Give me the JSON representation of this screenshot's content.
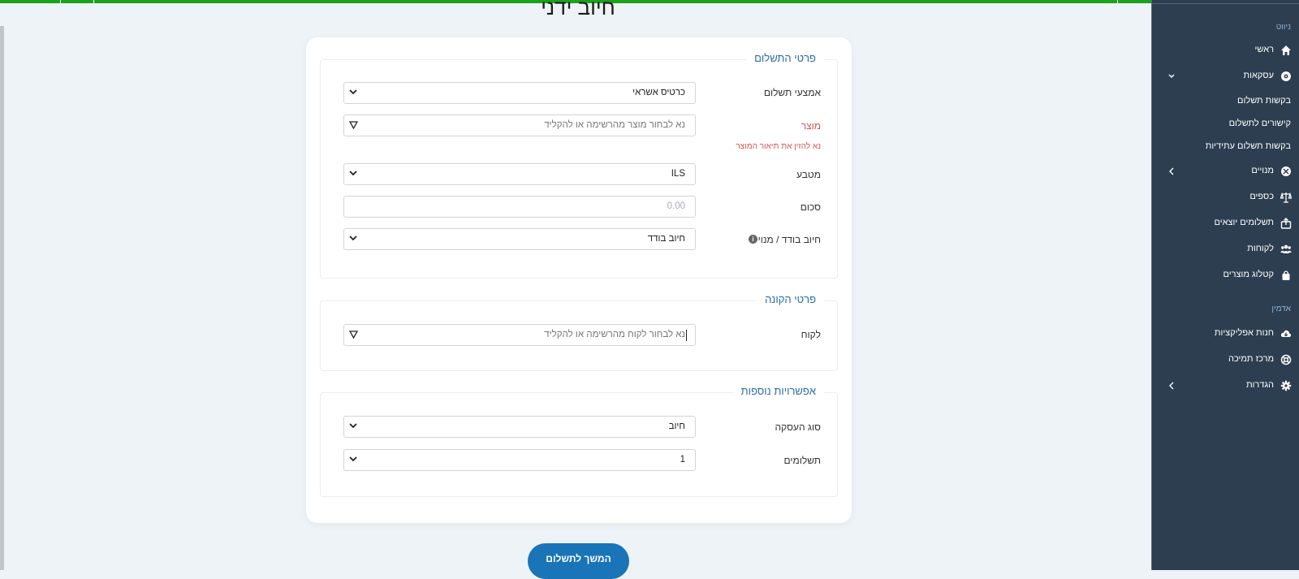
{
  "page": {
    "title": "חיוב ידני",
    "cta_label": "המשך לתשלום"
  },
  "payment_section": {
    "legend": "פרטי התשלום",
    "method_label": "אמצעי תשלום",
    "method_value": "כרטיס אשראי",
    "product_label": "מוצר",
    "product_placeholder": "נא לבחור מוצר מהרשימה או להקליד",
    "product_error": "נא להזין את תיאור המוצר",
    "currency_label": "מטבע",
    "currency_value": "ILS",
    "amount_label": "סכום",
    "amount_placeholder": "0.00",
    "charge_type_label": "חיוב בודד / מנוי",
    "charge_type_value": "חיוב בודד"
  },
  "buyer_section": {
    "legend": "פרטי הקונה",
    "customer_label": "לקוח",
    "customer_placeholder": "נא לבחור לקוח מהרשימה או להקליד"
  },
  "extra_section": {
    "legend": "אפשרויות נוספות",
    "transaction_type_label": "סוג העסקה",
    "transaction_type_value": "חיוב",
    "installments_label": "תשלומים",
    "installments_value": "1"
  },
  "sidebar": {
    "nav_header": "ניווט",
    "admin_header": "אדמין",
    "items": {
      "home": "ראשי",
      "transactions": "עסקאות",
      "payment_requests": "בקשות תשלום",
      "payment_links": "קישורים לתשלום",
      "future_requests": "בקשות תשלום עתידיות",
      "subscriptions": "מנויים",
      "funds": "כספים",
      "outgoing_payments": "תשלומים יוצאים",
      "customers": "לקוחות",
      "catalog": "קטלוג מוצרים",
      "app_store": "חנות אפליקציות",
      "support": "מרכז תמיכה",
      "settings": "הגדרות"
    }
  },
  "colors": {
    "sidebar_bg": "#2c3e50",
    "accent": "#1a74b8",
    "legend": "#2c6fa8",
    "error": "#d9534f",
    "topbar": "#1aa31a"
  }
}
